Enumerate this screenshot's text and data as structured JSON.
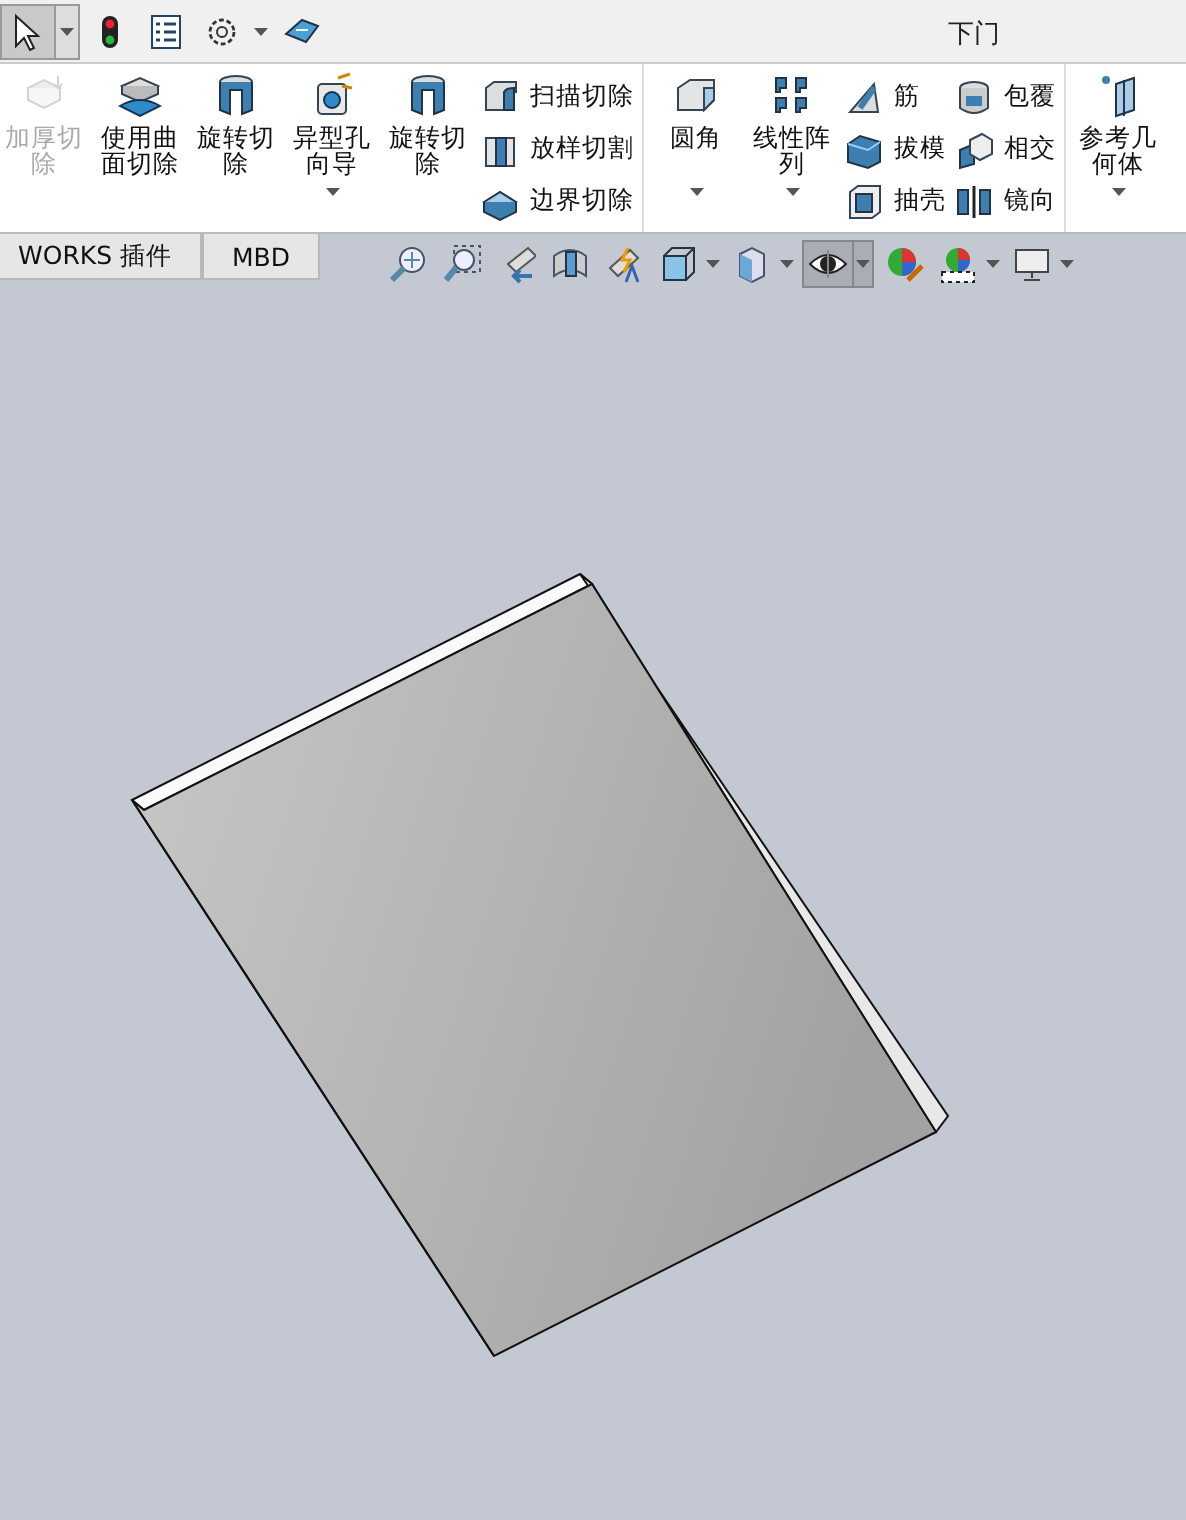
{
  "quick_toolbar": [
    {
      "pressed": true,
      "dropdown": true
    },
    {
      "pressed": false,
      "dropdown": false
    },
    {
      "pressed": false,
      "dropdown": false
    },
    {
      "pressed": false,
      "dropdown": true
    },
    {
      "pressed": false,
      "dropdown": false
    }
  ],
  "window": {
    "title": "下门"
  },
  "ribbon": {
    "groups": [
      {
        "items": [
          {
            "kind": "large",
            "label": "加厚切除",
            "disabled": true,
            "dropdown": false
          },
          {
            "kind": "large",
            "label": "使用曲面切除",
            "disabled": false,
            "dropdown": false
          },
          {
            "kind": "large",
            "label": "旋转切除",
            "disabled": false,
            "dropdown": false
          },
          {
            "kind": "large",
            "label": "异型孔向导",
            "disabled": false,
            "dropdown": true
          },
          {
            "kind": "large",
            "label": "旋转切除",
            "disabled": false,
            "dropdown": false
          },
          {
            "kind": "column",
            "entries": [
              {
                "label": "扫描切除",
                "disabled": false
              },
              {
                "label": "放样切割",
                "disabled": false
              },
              {
                "label": "边界切除",
                "disabled": false
              }
            ]
          }
        ]
      },
      {
        "items": [
          {
            "kind": "large",
            "label": "圆角",
            "disabled": false,
            "dropdown": true
          },
          {
            "kind": "large",
            "label": "线性阵列",
            "disabled": false,
            "dropdown": true
          },
          {
            "kind": "column",
            "entries": [
              {
                "label": "筋",
                "disabled": false
              },
              {
                "label": "拔模",
                "disabled": false
              },
              {
                "label": "抽壳",
                "disabled": false
              }
            ]
          },
          {
            "kind": "column",
            "entries": [
              {
                "label": "包覆",
                "disabled": false
              },
              {
                "label": "相交",
                "disabled": false
              },
              {
                "label": "镜向",
                "disabled": false
              }
            ]
          }
        ]
      },
      {
        "items": [
          {
            "kind": "large",
            "label": "参考几何体",
            "disabled": false,
            "dropdown": true
          }
        ]
      }
    ]
  },
  "tabs": [
    {
      "label": "WORKS 插件",
      "selected": false
    },
    {
      "label": "MBD",
      "selected": false
    }
  ],
  "view_toolbar": [
    {
      "pressed": false,
      "dropdown": false
    },
    {
      "pressed": false,
      "dropdown": false
    },
    {
      "pressed": false,
      "dropdown": false
    },
    {
      "pressed": false,
      "dropdown": false
    },
    {
      "pressed": false,
      "dropdown": false
    },
    {
      "pressed": false,
      "dropdown": true
    },
    {
      "pressed": false,
      "dropdown": true
    },
    {
      "pressed": true,
      "dropdown": true
    },
    {
      "pressed": false,
      "dropdown": false
    },
    {
      "pressed": false,
      "dropdown": true
    },
    {
      "pressed": false,
      "dropdown": true
    }
  ],
  "model": {
    "kind": "plate"
  }
}
